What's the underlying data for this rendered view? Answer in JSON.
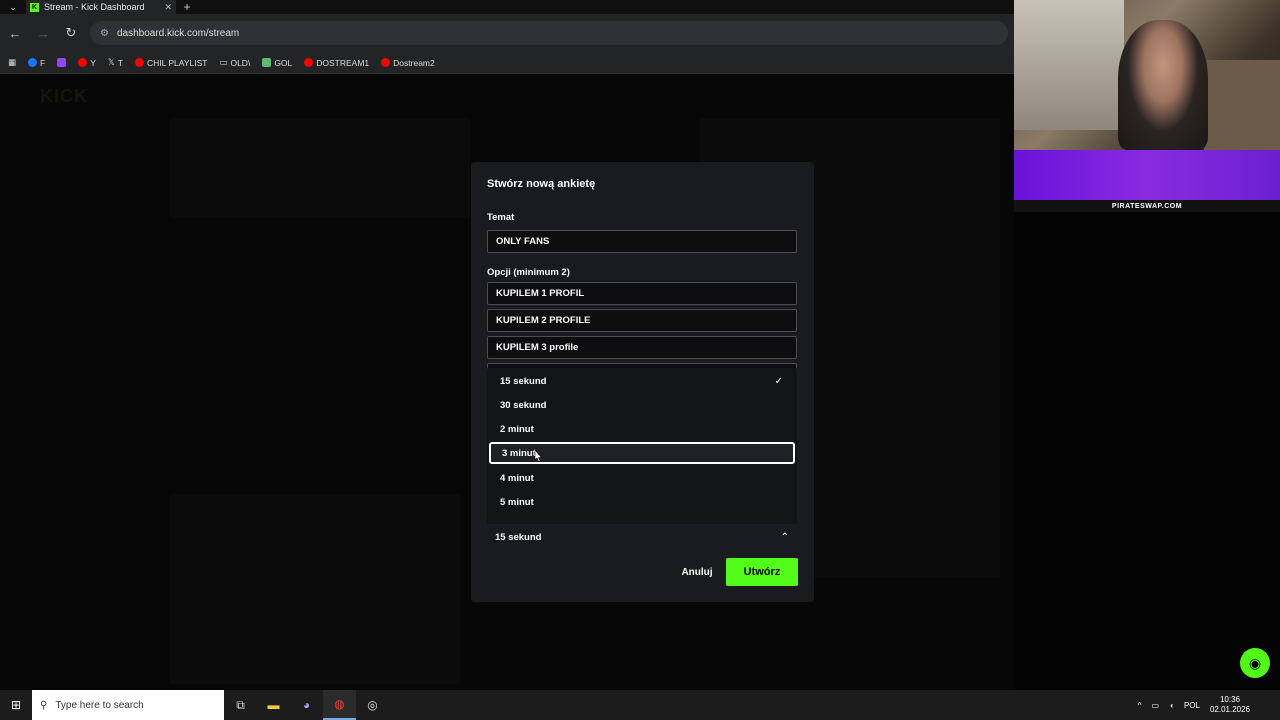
{
  "browser": {
    "tab_title": "Stream - Kick Dashboard",
    "url": "dashboard.kick.com/stream",
    "bookmarks": [
      {
        "label": "F",
        "color": "#1877f2"
      },
      {
        "label": "",
        "color": "#9146ff"
      },
      {
        "label": "Y",
        "color": "#ff0000"
      },
      {
        "label": "T",
        "color": "#ffffff"
      },
      {
        "label": "CHIL PLAYLIST",
        "color": "#ff0000"
      },
      {
        "label": "OLD\\",
        "color": "#cccccc"
      },
      {
        "label": "GOL",
        "color": "#5bb974"
      },
      {
        "label": "DOSTREAM1",
        "color": "#ff0000"
      },
      {
        "label": "Dostream2",
        "color": "#ff0000"
      }
    ]
  },
  "webcam": {
    "promo_text": "PIRATESWAP.COM"
  },
  "dialog": {
    "title": "Stwórz nową ankietę",
    "topic_label": "Temat",
    "topic_value": "ONLY FANS",
    "options_label": "Opcji (minimum 2)",
    "options": [
      "KUPILEM 1 PROFIL",
      "KUPILEM 2 PROFILE",
      "KUPILEM 3 profile"
    ],
    "duration": {
      "selected": "15 sekund",
      "items": [
        "15 sekund",
        "30 sekund",
        "2 minut",
        "3 minut",
        "4 minut",
        "5 minut"
      ],
      "checked_index": 0,
      "highlighted_index": 3
    },
    "cancel_label": "Anuluj",
    "create_label": "Utwórz"
  },
  "taskbar": {
    "search_placeholder": "Type here to search",
    "language": "POL",
    "time": "10:36",
    "date": "02.01.2026"
  },
  "colors": {
    "accent": "#53fc18",
    "modal_bg": "#191b1f",
    "field_bg": "#0e0e10"
  }
}
